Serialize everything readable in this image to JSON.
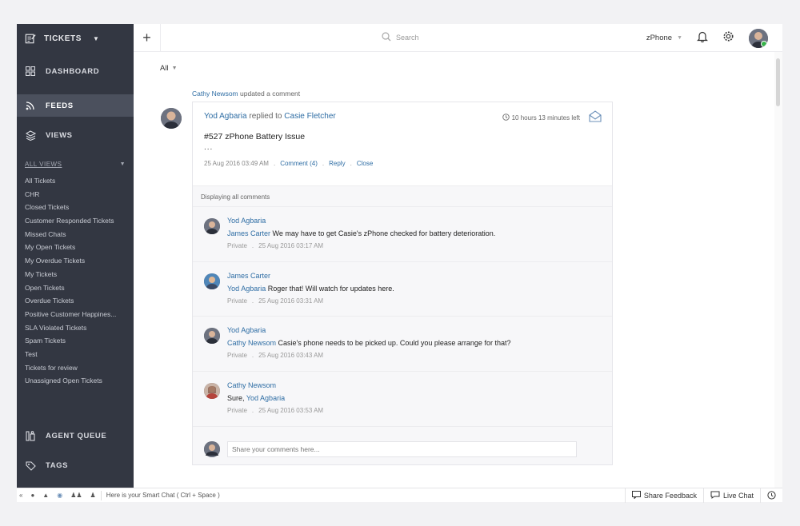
{
  "sidebar": {
    "module_title": "TICKETS",
    "nav": [
      {
        "label": "DASHBOARD",
        "icon": "grid-icon"
      },
      {
        "label": "FEEDS",
        "icon": "rss-icon",
        "active": true
      },
      {
        "label": "VIEWS",
        "icon": "layers-icon"
      }
    ],
    "views_title": "ALL VIEWS",
    "views": [
      "All Tickets",
      "CHR",
      "Closed Tickets",
      "Customer Responded Tickets",
      "Missed Chats",
      "My Open Tickets",
      "My Overdue Tickets",
      "My Tickets",
      "Open Tickets",
      "Overdue Tickets",
      "Positive Customer Happines...",
      "SLA Violated Tickets",
      "Spam Tickets",
      "Test",
      "Tickets for review",
      "Unassigned Open Tickets"
    ],
    "bottom_nav": [
      {
        "label": "AGENT QUEUE",
        "icon": "agent-queue-icon"
      },
      {
        "label": "TAGS",
        "icon": "tag-icon"
      }
    ]
  },
  "topbar": {
    "search_placeholder": "Search",
    "department": "zPhone"
  },
  "feed": {
    "filter": "All",
    "activity_actor": "Cathy Newsom",
    "activity_action": "updated a comment",
    "card": {
      "replier": "Yod Agbaria",
      "replied_text": "replied to",
      "recipient": "Casie Fletcher",
      "time_left": "10 hours 13 minutes left",
      "subject": "#527 zPhone Battery Issue",
      "ellipsis": "...",
      "date": "25 Aug 2016 03:49 AM",
      "actions": [
        "Comment (4)",
        "Reply",
        "Close"
      ],
      "comments_header": "Displaying all comments",
      "comments": [
        {
          "author": "Yod Agbaria",
          "mention": "James Carter",
          "text": "We may have to get Casie's zPhone checked for battery deterioration.",
          "visibility": "Private",
          "date": "25 Aug 2016 03:17 AM"
        },
        {
          "author": "James Carter",
          "mention": "Yod Agbaria",
          "text": "Roger that! Will watch for updates here.",
          "visibility": "Private",
          "date": "25 Aug 2016 03:31 AM"
        },
        {
          "author": "Yod Agbaria",
          "mention": "Cathy Newsom",
          "text": "Casie's phone needs to be picked up. Could you please arrange for that?",
          "visibility": "Private",
          "date": "25 Aug 2016 03:43 AM"
        },
        {
          "author": "Cathy Newsom",
          "prefix": "Sure,",
          "mention": "Yod Agbaria",
          "text": "",
          "visibility": "Private",
          "date": "25 Aug 2016 03:53 AM"
        }
      ],
      "share_placeholder": "Share your comments here..."
    }
  },
  "footer": {
    "smart_chat_hint": "Here is your Smart Chat ( Ctrl + Space )",
    "share_feedback": "Share Feedback",
    "live_chat": "Live Chat"
  },
  "colors": {
    "sidebar_bg": "#333742",
    "sidebar_active": "#4b505d",
    "link": "#2e6da4",
    "online": "#37b34a"
  }
}
